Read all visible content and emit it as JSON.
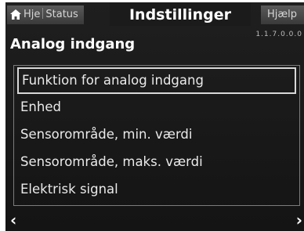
{
  "tabs": {
    "home_label": "Hje",
    "status_label": "Status",
    "active_label": "Indstillinger",
    "help_label": "Hjælp"
  },
  "page": {
    "title": "Analog indgang",
    "version": "1.1.7.0.0.0"
  },
  "menu": {
    "items": [
      {
        "label": "Funktion for analog indgang",
        "selected": true
      },
      {
        "label": "Enhed"
      },
      {
        "label": "Sensorområde, min. værdi"
      },
      {
        "label": "Sensorområde, maks. værdi"
      },
      {
        "label": "Elektrisk signal"
      }
    ]
  },
  "icons": {
    "home": "home-icon",
    "prev": "chevron-left-icon",
    "next": "chevron-right-icon"
  },
  "nav": {
    "prev_glyph": "‹",
    "next_glyph": "›"
  },
  "colors": {
    "screen_bg": "#1b1b1b",
    "tab_bg": "#4a4a4a",
    "text": "#eaeaea"
  }
}
